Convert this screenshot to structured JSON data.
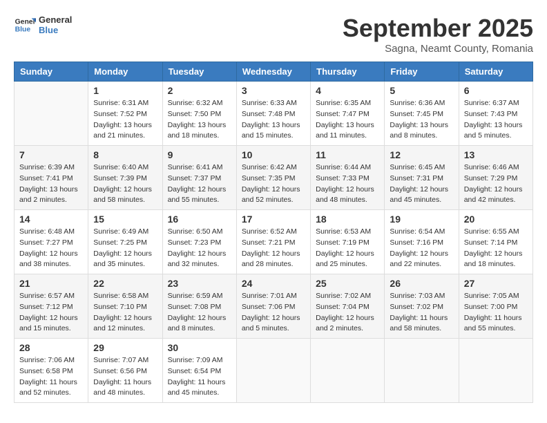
{
  "header": {
    "logo_line1": "General",
    "logo_line2": "Blue",
    "month": "September 2025",
    "location": "Sagna, Neamt County, Romania"
  },
  "weekdays": [
    "Sunday",
    "Monday",
    "Tuesday",
    "Wednesday",
    "Thursday",
    "Friday",
    "Saturday"
  ],
  "weeks": [
    [
      {
        "day": "",
        "sunrise": "",
        "sunset": "",
        "daylight": ""
      },
      {
        "day": "1",
        "sunrise": "Sunrise: 6:31 AM",
        "sunset": "Sunset: 7:52 PM",
        "daylight": "Daylight: 13 hours and 21 minutes."
      },
      {
        "day": "2",
        "sunrise": "Sunrise: 6:32 AM",
        "sunset": "Sunset: 7:50 PM",
        "daylight": "Daylight: 13 hours and 18 minutes."
      },
      {
        "day": "3",
        "sunrise": "Sunrise: 6:33 AM",
        "sunset": "Sunset: 7:48 PM",
        "daylight": "Daylight: 13 hours and 15 minutes."
      },
      {
        "day": "4",
        "sunrise": "Sunrise: 6:35 AM",
        "sunset": "Sunset: 7:47 PM",
        "daylight": "Daylight: 13 hours and 11 minutes."
      },
      {
        "day": "5",
        "sunrise": "Sunrise: 6:36 AM",
        "sunset": "Sunset: 7:45 PM",
        "daylight": "Daylight: 13 hours and 8 minutes."
      },
      {
        "day": "6",
        "sunrise": "Sunrise: 6:37 AM",
        "sunset": "Sunset: 7:43 PM",
        "daylight": "Daylight: 13 hours and 5 minutes."
      }
    ],
    [
      {
        "day": "7",
        "sunrise": "Sunrise: 6:39 AM",
        "sunset": "Sunset: 7:41 PM",
        "daylight": "Daylight: 13 hours and 2 minutes."
      },
      {
        "day": "8",
        "sunrise": "Sunrise: 6:40 AM",
        "sunset": "Sunset: 7:39 PM",
        "daylight": "Daylight: 12 hours and 58 minutes."
      },
      {
        "day": "9",
        "sunrise": "Sunrise: 6:41 AM",
        "sunset": "Sunset: 7:37 PM",
        "daylight": "Daylight: 12 hours and 55 minutes."
      },
      {
        "day": "10",
        "sunrise": "Sunrise: 6:42 AM",
        "sunset": "Sunset: 7:35 PM",
        "daylight": "Daylight: 12 hours and 52 minutes."
      },
      {
        "day": "11",
        "sunrise": "Sunrise: 6:44 AM",
        "sunset": "Sunset: 7:33 PM",
        "daylight": "Daylight: 12 hours and 48 minutes."
      },
      {
        "day": "12",
        "sunrise": "Sunrise: 6:45 AM",
        "sunset": "Sunset: 7:31 PM",
        "daylight": "Daylight: 12 hours and 45 minutes."
      },
      {
        "day": "13",
        "sunrise": "Sunrise: 6:46 AM",
        "sunset": "Sunset: 7:29 PM",
        "daylight": "Daylight: 12 hours and 42 minutes."
      }
    ],
    [
      {
        "day": "14",
        "sunrise": "Sunrise: 6:48 AM",
        "sunset": "Sunset: 7:27 PM",
        "daylight": "Daylight: 12 hours and 38 minutes."
      },
      {
        "day": "15",
        "sunrise": "Sunrise: 6:49 AM",
        "sunset": "Sunset: 7:25 PM",
        "daylight": "Daylight: 12 hours and 35 minutes."
      },
      {
        "day": "16",
        "sunrise": "Sunrise: 6:50 AM",
        "sunset": "Sunset: 7:23 PM",
        "daylight": "Daylight: 12 hours and 32 minutes."
      },
      {
        "day": "17",
        "sunrise": "Sunrise: 6:52 AM",
        "sunset": "Sunset: 7:21 PM",
        "daylight": "Daylight: 12 hours and 28 minutes."
      },
      {
        "day": "18",
        "sunrise": "Sunrise: 6:53 AM",
        "sunset": "Sunset: 7:19 PM",
        "daylight": "Daylight: 12 hours and 25 minutes."
      },
      {
        "day": "19",
        "sunrise": "Sunrise: 6:54 AM",
        "sunset": "Sunset: 7:16 PM",
        "daylight": "Daylight: 12 hours and 22 minutes."
      },
      {
        "day": "20",
        "sunrise": "Sunrise: 6:55 AM",
        "sunset": "Sunset: 7:14 PM",
        "daylight": "Daylight: 12 hours and 18 minutes."
      }
    ],
    [
      {
        "day": "21",
        "sunrise": "Sunrise: 6:57 AM",
        "sunset": "Sunset: 7:12 PM",
        "daylight": "Daylight: 12 hours and 15 minutes."
      },
      {
        "day": "22",
        "sunrise": "Sunrise: 6:58 AM",
        "sunset": "Sunset: 7:10 PM",
        "daylight": "Daylight: 12 hours and 12 minutes."
      },
      {
        "day": "23",
        "sunrise": "Sunrise: 6:59 AM",
        "sunset": "Sunset: 7:08 PM",
        "daylight": "Daylight: 12 hours and 8 minutes."
      },
      {
        "day": "24",
        "sunrise": "Sunrise: 7:01 AM",
        "sunset": "Sunset: 7:06 PM",
        "daylight": "Daylight: 12 hours and 5 minutes."
      },
      {
        "day": "25",
        "sunrise": "Sunrise: 7:02 AM",
        "sunset": "Sunset: 7:04 PM",
        "daylight": "Daylight: 12 hours and 2 minutes."
      },
      {
        "day": "26",
        "sunrise": "Sunrise: 7:03 AM",
        "sunset": "Sunset: 7:02 PM",
        "daylight": "Daylight: 11 hours and 58 minutes."
      },
      {
        "day": "27",
        "sunrise": "Sunrise: 7:05 AM",
        "sunset": "Sunset: 7:00 PM",
        "daylight": "Daylight: 11 hours and 55 minutes."
      }
    ],
    [
      {
        "day": "28",
        "sunrise": "Sunrise: 7:06 AM",
        "sunset": "Sunset: 6:58 PM",
        "daylight": "Daylight: 11 hours and 52 minutes."
      },
      {
        "day": "29",
        "sunrise": "Sunrise: 7:07 AM",
        "sunset": "Sunset: 6:56 PM",
        "daylight": "Daylight: 11 hours and 48 minutes."
      },
      {
        "day": "30",
        "sunrise": "Sunrise: 7:09 AM",
        "sunset": "Sunset: 6:54 PM",
        "daylight": "Daylight: 11 hours and 45 minutes."
      },
      {
        "day": "",
        "sunrise": "",
        "sunset": "",
        "daylight": ""
      },
      {
        "day": "",
        "sunrise": "",
        "sunset": "",
        "daylight": ""
      },
      {
        "day": "",
        "sunrise": "",
        "sunset": "",
        "daylight": ""
      },
      {
        "day": "",
        "sunrise": "",
        "sunset": "",
        "daylight": ""
      }
    ]
  ]
}
